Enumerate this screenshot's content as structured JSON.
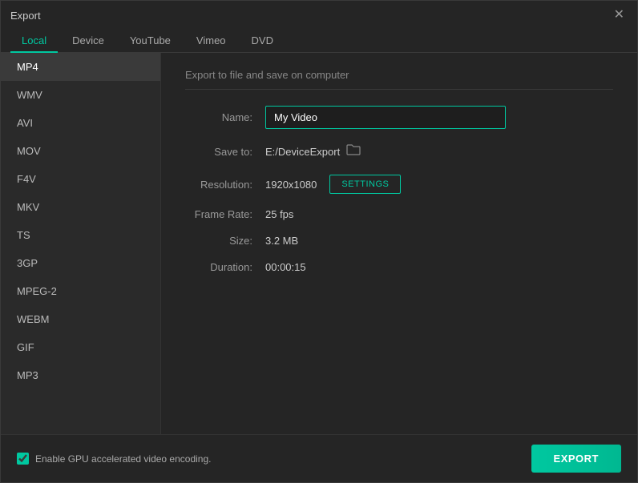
{
  "window": {
    "title": "Export",
    "close_label": "✕"
  },
  "tabs": [
    {
      "id": "local",
      "label": "Local",
      "active": true
    },
    {
      "id": "device",
      "label": "Device",
      "active": false
    },
    {
      "id": "youtube",
      "label": "YouTube",
      "active": false
    },
    {
      "id": "vimeo",
      "label": "Vimeo",
      "active": false
    },
    {
      "id": "dvd",
      "label": "DVD",
      "active": false
    }
  ],
  "sidebar": {
    "items": [
      {
        "id": "mp4",
        "label": "MP4",
        "active": true
      },
      {
        "id": "wmv",
        "label": "WMV",
        "active": false
      },
      {
        "id": "avi",
        "label": "AVI",
        "active": false
      },
      {
        "id": "mov",
        "label": "MOV",
        "active": false
      },
      {
        "id": "f4v",
        "label": "F4V",
        "active": false
      },
      {
        "id": "mkv",
        "label": "MKV",
        "active": false
      },
      {
        "id": "ts",
        "label": "TS",
        "active": false
      },
      {
        "id": "3gp",
        "label": "3GP",
        "active": false
      },
      {
        "id": "mpeg2",
        "label": "MPEG-2",
        "active": false
      },
      {
        "id": "webm",
        "label": "WEBM",
        "active": false
      },
      {
        "id": "gif",
        "label": "GIF",
        "active": false
      },
      {
        "id": "mp3",
        "label": "MP3",
        "active": false
      }
    ]
  },
  "panel": {
    "title": "Export to file and save on computer",
    "name_label": "Name:",
    "name_value": "My Video",
    "save_to_label": "Save to:",
    "save_to_path": "E:/DeviceExport",
    "resolution_label": "Resolution:",
    "resolution_value": "1920x1080",
    "settings_button": "SETTINGS",
    "frame_rate_label": "Frame Rate:",
    "frame_rate_value": "25 fps",
    "size_label": "Size:",
    "size_value": "3.2 MB",
    "duration_label": "Duration:",
    "duration_value": "00:00:15"
  },
  "footer": {
    "gpu_label": "Enable GPU accelerated video encoding.",
    "export_button": "EXPORT"
  },
  "icons": {
    "folder": "🗁",
    "close": "✕",
    "checkbox_checked": "✓"
  }
}
